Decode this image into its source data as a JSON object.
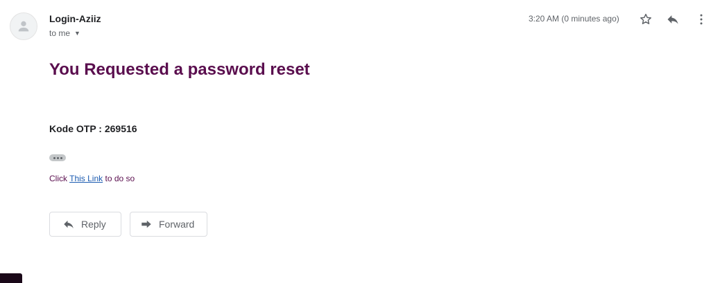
{
  "message": {
    "sender_name": "Login-Aziiz",
    "recipient_label": "to me",
    "timestamp": "3:20 AM (0 minutes ago)",
    "subject": "You Requested a password reset",
    "otp_line": "Kode OTP : 269516",
    "body_prefix": "Click",
    "link_text": "This Link",
    "body_suffix": "to do so"
  },
  "actions": {
    "reply_label": "Reply",
    "forward_label": "Forward"
  },
  "icons": {
    "avatar": "person-icon",
    "recipient_caret": "chevron-down-icon",
    "star": "star-icon",
    "reply": "reply-icon",
    "more": "more-vertical-icon",
    "ellipsis": "more-horizontal-icon",
    "forward": "forward-icon"
  },
  "colors": {
    "subject": "#5a0e4e",
    "link": "#1a5ab0",
    "muted_text": "#5f6368"
  }
}
